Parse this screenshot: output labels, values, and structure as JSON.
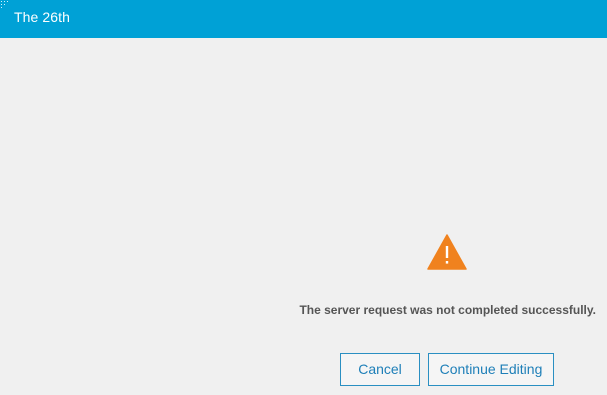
{
  "window": {
    "title": "The 26th"
  },
  "dialog": {
    "icon": "warning-triangle-icon",
    "icon_color": "#f0821e",
    "message": "The server request was not completed successfully.",
    "buttons": {
      "cancel_label": "Cancel",
      "continue_label": "Continue Editing"
    }
  },
  "colors": {
    "title_bar": "#00a1d6",
    "background": "#f0f0f0",
    "button_accent": "#1e7fb8"
  }
}
